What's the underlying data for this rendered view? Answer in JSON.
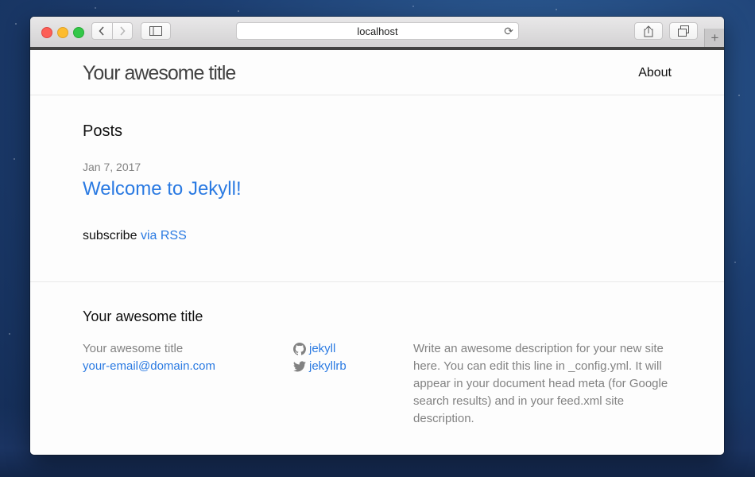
{
  "browser": {
    "url": "localhost"
  },
  "site": {
    "title": "Your awesome title",
    "nav": {
      "about": "About"
    }
  },
  "main": {
    "heading": "Posts",
    "posts": [
      {
        "date": "Jan 7, 2017",
        "title": "Welcome to Jekyll!"
      }
    ],
    "subscribe_prefix": "subscribe",
    "subscribe_link": "via RSS"
  },
  "footer": {
    "heading": "Your awesome title",
    "name": "Your awesome title",
    "email": "your-email@domain.com",
    "github": "jekyll",
    "twitter": "jekyllrb",
    "description": "Write an awesome description for your new site here. You can edit this line in _config.yml. It will appear in your document head meta (for Google search results) and in your feed.xml site description."
  },
  "colors": {
    "link": "#2a7ae2",
    "muted_text": "#828282"
  }
}
